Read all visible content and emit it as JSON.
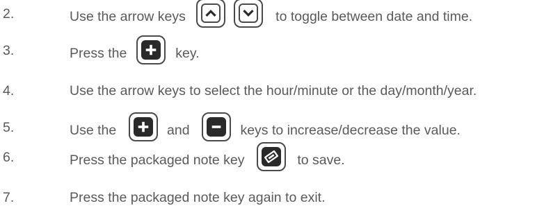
{
  "steps": [
    {
      "number": "2.",
      "before": "Use the arrow keys",
      "after": "to toggle between date and time.",
      "keys": [
        "up-arrow-icon",
        "down-arrow-icon"
      ]
    },
    {
      "number": "3.",
      "before": "Press the",
      "after": "key.",
      "keys": [
        "plus-icon"
      ]
    },
    {
      "number": "4.",
      "text": "Use the arrow keys to select the hour/minute or the day/month/year."
    },
    {
      "number": "5.",
      "before": "Use the",
      "middle": "and",
      "after": "keys to increase/decrease the value.",
      "keys": [
        "plus-icon",
        "minus-icon"
      ]
    },
    {
      "number": "6.",
      "before": "Press the packaged note key",
      "after": "to save.",
      "keys": [
        "packaged-note-icon"
      ]
    },
    {
      "number": "7.",
      "text": "Press the packaged note key again to exit."
    }
  ]
}
